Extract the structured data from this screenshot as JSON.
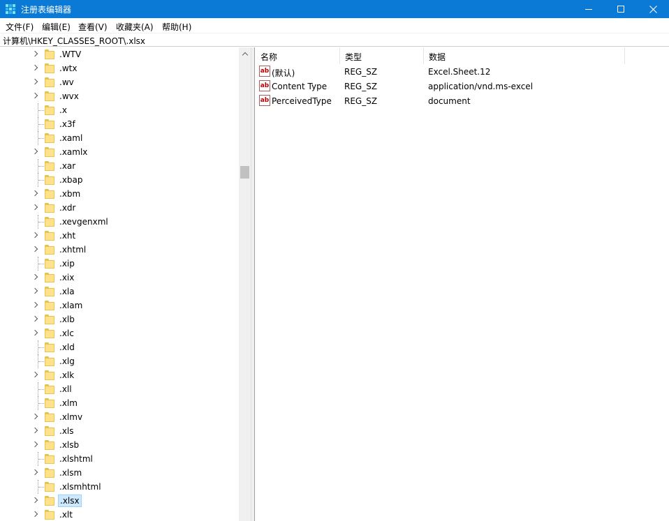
{
  "window": {
    "title": "注册表编辑器",
    "controls": {
      "minimize": "minimize-icon",
      "maximize": "maximize-icon",
      "close": "close-icon"
    }
  },
  "menu": [
    "文件(F)",
    "编辑(E)",
    "查看(V)",
    "收藏夹(A)",
    "帮助(H)"
  ],
  "address": "计算机\\HKEY_CLASSES_ROOT\\.xlsx",
  "tree": {
    "selected": ".xlsx",
    "items": [
      {
        "label": ".WTV",
        "expandable": true
      },
      {
        "label": ".wtx",
        "expandable": true
      },
      {
        "label": ".wv",
        "expandable": true
      },
      {
        "label": ".wvx",
        "expandable": true
      },
      {
        "label": ".x",
        "expandable": false
      },
      {
        "label": ".x3f",
        "expandable": false
      },
      {
        "label": ".xaml",
        "expandable": false
      },
      {
        "label": ".xamlx",
        "expandable": true
      },
      {
        "label": ".xar",
        "expandable": false
      },
      {
        "label": ".xbap",
        "expandable": false
      },
      {
        "label": ".xbm",
        "expandable": true
      },
      {
        "label": ".xdr",
        "expandable": true
      },
      {
        "label": ".xevgenxml",
        "expandable": false
      },
      {
        "label": ".xht",
        "expandable": true
      },
      {
        "label": ".xhtml",
        "expandable": true
      },
      {
        "label": ".xip",
        "expandable": false
      },
      {
        "label": ".xix",
        "expandable": true
      },
      {
        "label": ".xla",
        "expandable": true
      },
      {
        "label": ".xlam",
        "expandable": true
      },
      {
        "label": ".xlb",
        "expandable": true
      },
      {
        "label": ".xlc",
        "expandable": true
      },
      {
        "label": ".xld",
        "expandable": false
      },
      {
        "label": ".xlg",
        "expandable": false
      },
      {
        "label": ".xlk",
        "expandable": true
      },
      {
        "label": ".xll",
        "expandable": false
      },
      {
        "label": ".xlm",
        "expandable": false
      },
      {
        "label": ".xlmv",
        "expandable": true
      },
      {
        "label": ".xls",
        "expandable": true
      },
      {
        "label": ".xlsb",
        "expandable": true
      },
      {
        "label": ".xlshtml",
        "expandable": false
      },
      {
        "label": ".xlsm",
        "expandable": true
      },
      {
        "label": ".xlsmhtml",
        "expandable": false
      },
      {
        "label": ".xlsx",
        "expandable": true
      },
      {
        "label": ".xlt",
        "expandable": true
      }
    ]
  },
  "list": {
    "columns": [
      "名称",
      "类型",
      "数据"
    ],
    "rows": [
      {
        "icon": "string-value-icon",
        "name": "(默认)",
        "type": "REG_SZ",
        "data": "Excel.Sheet.12"
      },
      {
        "icon": "string-value-icon",
        "name": "Content Type",
        "type": "REG_SZ",
        "data": "application/vnd.ms-excel"
      },
      {
        "icon": "string-value-icon",
        "name": "PerceivedType",
        "type": "REG_SZ",
        "data": "document"
      }
    ]
  },
  "colors": {
    "titlebar": "#0a7ad6",
    "selection": "#cce8ff",
    "folder": "#ffe28a"
  }
}
